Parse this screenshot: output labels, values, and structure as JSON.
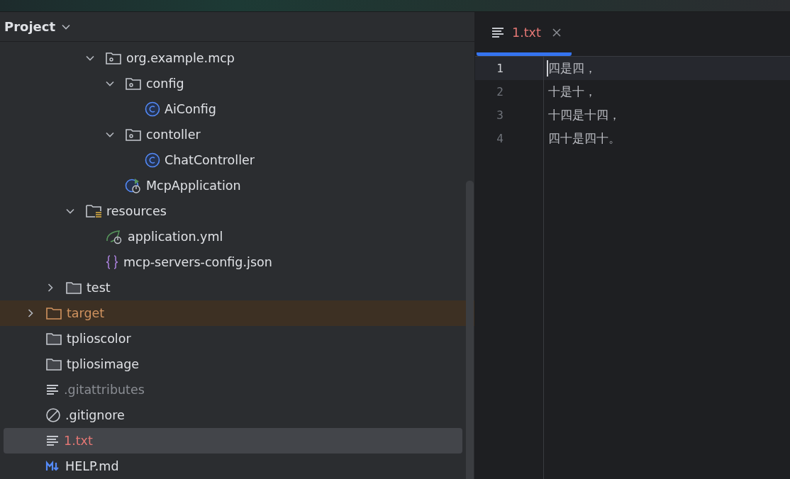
{
  "project_panel": {
    "title": "Project",
    "tree": [
      {
        "children": [
          {
            "children": [
              {
                "children": [
                  {
                    "label": "org.example.mcp",
                    "kind": "package",
                    "expanded": true,
                    "selected": false,
                    "children": [
                      {
                        "label": "config",
                        "kind": "package",
                        "expanded": true,
                        "selected": false,
                        "children": [
                          {
                            "label": "AiConfig",
                            "kind": "class",
                            "selected": false
                          }
                        ]
                      },
                      {
                        "label": "contoller",
                        "kind": "package",
                        "expanded": true,
                        "selected": false,
                        "children": [
                          {
                            "label": "ChatController",
                            "kind": "class",
                            "selected": false
                          }
                        ]
                      },
                      {
                        "label": "McpApplication",
                        "kind": "app",
                        "selected": false
                      }
                    ]
                  }
                ]
              },
              {
                "label": "resources",
                "kind": "resources",
                "expanded": true,
                "selected": false,
                "children": [
                  {
                    "label": "application.yml",
                    "kind": "yml",
                    "selected": false
                  },
                  {
                    "label": "mcp-servers-config.json",
                    "kind": "json",
                    "selected": false
                  }
                ]
              }
            ]
          },
          {
            "label": "test",
            "kind": "folder",
            "expanded": false,
            "selected": false
          }
        ]
      },
      {
        "label": "target",
        "kind": "folder",
        "expanded": false,
        "selected": false,
        "excluded": true,
        "ignored": false,
        "untracked": false
      },
      {
        "label": "tplioscolor",
        "kind": "folder",
        "selected": false,
        "excluded": false,
        "ignored": false,
        "untracked": false
      },
      {
        "label": "tpliosimage",
        "kind": "folder",
        "selected": false,
        "excluded": false,
        "ignored": false,
        "untracked": false
      },
      {
        "label": ".gitattributes",
        "kind": "text",
        "selected": false,
        "excluded": false,
        "ignored": true,
        "untracked": false
      },
      {
        "label": ".gitignore",
        "kind": "ignore",
        "selected": false,
        "excluded": false,
        "ignored": false,
        "untracked": false
      },
      {
        "label": "1.txt",
        "kind": "text",
        "selected": true,
        "excluded": false,
        "ignored": false,
        "untracked": true
      },
      {
        "label": "HELP.md",
        "kind": "markdown",
        "selected": false,
        "excluded": false,
        "ignored": false,
        "untracked": false
      }
    ]
  },
  "editor": {
    "tabs": [
      {
        "label": "1.txt",
        "selected": true,
        "untracked": true
      }
    ],
    "lines": [
      {
        "number": "1",
        "text": "四是四，",
        "current": true
      },
      {
        "number": "2",
        "text": "十是十，",
        "current": false
      },
      {
        "number": "3",
        "text": "十四是十四，",
        "current": false
      },
      {
        "number": "4",
        "text": "四十是四十。",
        "current": false
      }
    ]
  }
}
